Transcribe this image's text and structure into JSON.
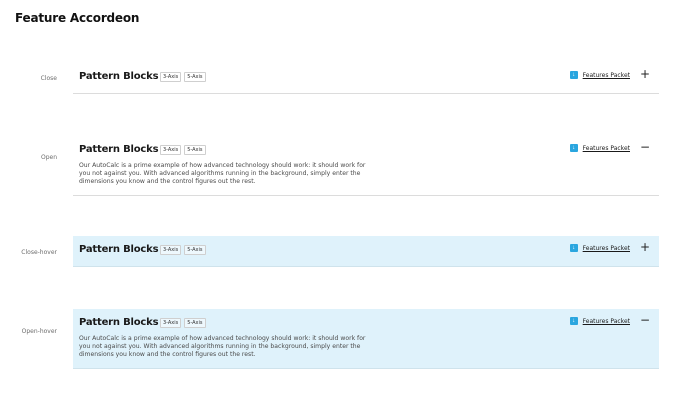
{
  "page_title": "Feature Accordeon",
  "accordions": [
    {
      "state_label": "Close",
      "title": "Pattern Blocks",
      "tags": [
        "3-Axis",
        "5-Axis"
      ],
      "packet_label": "Features Packet",
      "toggle": "+",
      "body": ""
    },
    {
      "state_label": "Open",
      "title": "Pattern Blocks",
      "tags": [
        "3-Axis",
        "5-Axis"
      ],
      "packet_label": "Features Packet",
      "toggle": "−",
      "body": "Our AutoCalc is a prime example of how advanced technology should work: it should work for you not against you.  With advanced algorithms running in the background, simply enter the dimensions you know and the control figures out the rest."
    },
    {
      "state_label": "Close-hover",
      "title": "Pattern Blocks",
      "tags": [
        "3-Axis",
        "5-Axis"
      ],
      "packet_label": "Features Packet",
      "toggle": "+",
      "body": ""
    },
    {
      "state_label": "Open-hover",
      "title": "Pattern Blocks",
      "tags": [
        "3-Axis",
        "5-Axis"
      ],
      "packet_label": "Features Packet",
      "toggle": "−",
      "body": "Our AutoCalc is a prime example of how advanced technology should work: it should work for you not against you.  With advanced algorithms running in the background, simply enter the dimensions you know and the control figures out the rest."
    }
  ],
  "colors": {
    "hover_background": "#dff2fb",
    "download_icon": "#2aa6df",
    "divider": "#dcdcdc"
  },
  "icons": {
    "download": "download-icon",
    "expand": "plus-icon",
    "collapse": "minus-icon"
  }
}
